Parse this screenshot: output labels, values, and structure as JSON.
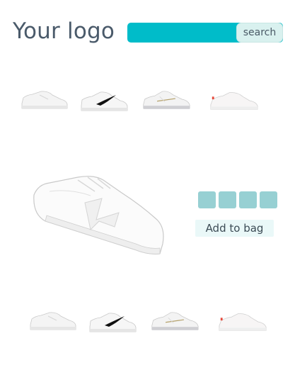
{
  "header": {
    "logo_text": "Your logo",
    "search_button_label": "search",
    "accent_color": "#00bcc9"
  },
  "top_thumbnails": [
    {
      "icon": "white-sneaker-icon"
    },
    {
      "icon": "white-sneaker-black-swoosh-icon"
    },
    {
      "icon": "white-sneaker-gold-stripe-icon"
    },
    {
      "icon": "white-sneaker-red-tab-icon"
    }
  ],
  "hero_product": {
    "icon": "white-sneaker-large-image"
  },
  "options": {
    "swatch_color": "#97d0d3",
    "swatch_count": 4,
    "add_to_bag_label": "Add to bag"
  },
  "bottom_thumbnails": [
    {
      "icon": "white-sneaker-icon"
    },
    {
      "icon": "white-sneaker-black-swoosh-icon"
    },
    {
      "icon": "white-sneaker-gold-stripe-icon"
    },
    {
      "icon": "white-sneaker-red-tab-icon"
    }
  ]
}
